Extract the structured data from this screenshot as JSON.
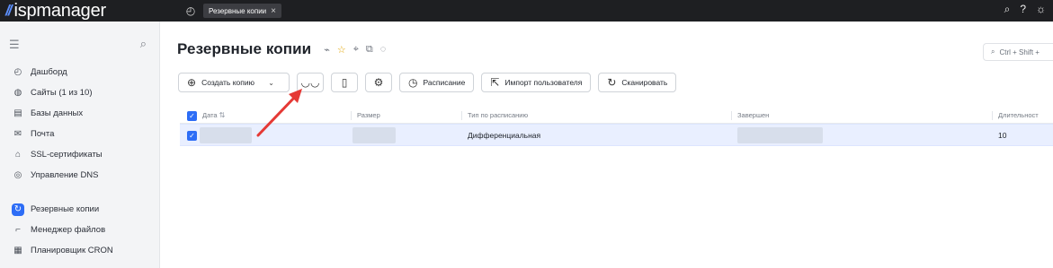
{
  "app": {
    "logo_mark": "//",
    "logo_text": "ispmanager",
    "open_tab": "Резервные копии",
    "top_icons": [
      "search-icon",
      "help-icon",
      "settings-icon"
    ]
  },
  "sidebar": {
    "items": [
      {
        "label": "Дашборд",
        "icon": "dashboard-icon"
      },
      {
        "label": "Сайты (1 из 10)",
        "icon": "globe-icon"
      },
      {
        "label": "Базы данных",
        "icon": "database-icon"
      },
      {
        "label": "Почта",
        "icon": "mail-icon"
      },
      {
        "label": "SSL-сертификаты",
        "icon": "lock-icon"
      },
      {
        "label": "Управление DNS",
        "icon": "dns-icon"
      },
      {
        "label": "Резервные копии",
        "icon": "backup-icon",
        "active": true
      },
      {
        "label": "Менеджер файлов",
        "icon": "folder-icon"
      },
      {
        "label": "Планировщик CRON",
        "icon": "calendar-icon"
      }
    ]
  },
  "page": {
    "title": "Резервные копии",
    "search_shortcut": "Ctrl + Shift + ",
    "toolbar": {
      "create_label": "Создать копию",
      "schedule_label": "Расписание",
      "import_label": "Импорт пользователя",
      "scan_label": "Сканировать"
    }
  },
  "table": {
    "headers": [
      "Дата",
      "Размер",
      "Тип по расписанию",
      "Завершен",
      "Длительност"
    ],
    "rows": [
      {
        "type": "Дифференциальная",
        "duration": "10"
      }
    ]
  },
  "colors": {
    "accent": "#2d6df6",
    "arrow": "#e53935",
    "selected_row": "#e9efff"
  }
}
